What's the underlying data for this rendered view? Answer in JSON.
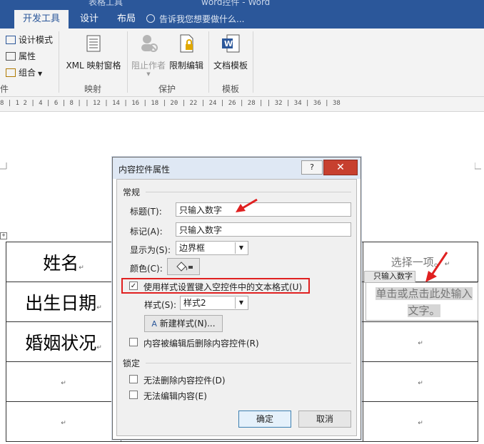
{
  "window": {
    "context_tab_title": "表格工具",
    "doc_title": "word控件 - Word"
  },
  "tabs": [
    {
      "label": "开发工具",
      "active": true
    },
    {
      "label": "设计",
      "active": false
    },
    {
      "label": "布局",
      "active": false
    }
  ],
  "tell_me": "告诉我您想要做什么...",
  "ribbon": {
    "design_mode": "设计模式",
    "properties": "属性",
    "group": "组合",
    "xml_mapping": "XML 映射窗格",
    "block_authors": "阻止作者",
    "restrict_editing": "限制编辑",
    "doc_template": "文档模板",
    "group_labels": {
      "controls_partial": "件",
      "mapping": "映射",
      "protect": "保护",
      "templates": "模板"
    }
  },
  "ruler": {
    "scale": "8 | 1 2 | 4 | 6 | 8 | | 12 | 14 | 16 | 18 | 20 | 22 | 24 | 26 | 28 | | 32 | 34 | 36 | 38"
  },
  "document": {
    "rows": [
      {
        "label": "姓名",
        "right": "选择一项。"
      },
      {
        "label": "出生日期",
        "right": ""
      },
      {
        "label": "婚姻状况",
        "right": ""
      },
      {
        "label": "",
        "right": ""
      },
      {
        "label": "",
        "right": ""
      }
    ],
    "content_control_tag": "只输入数字",
    "content_control_placeholder": "单击或点击此处输入文字。",
    "paragraph_mark": "↵"
  },
  "dialog": {
    "title": "内容控件属性",
    "help": "?",
    "close": "✕",
    "general_section": "常规",
    "title_label": "标题(T):",
    "title_value": "只输入数字",
    "tag_label": "标记(A):",
    "tag_value": "只输入数字",
    "show_as_label": "显示为(S):",
    "show_as_value": "边界框",
    "color_label": "颜色(C):",
    "use_style_label": "使用样式设置键入空控件中的文本格式(U)",
    "use_style_checked": true,
    "style_label": "样式(S):",
    "style_value": "样式2",
    "new_style_button": "新建样式(N)...",
    "remove_after_edit_label": "内容被编辑后删除内容控件(R)",
    "locking_section": "锁定",
    "cannot_delete_label": "无法删除内容控件(D)",
    "cannot_edit_label": "无法编辑内容(E)",
    "ok_button": "确定",
    "cancel_button": "取消"
  },
  "colors": {
    "ribbon_blue": "#2b579a",
    "highlight_red": "#e02020"
  }
}
